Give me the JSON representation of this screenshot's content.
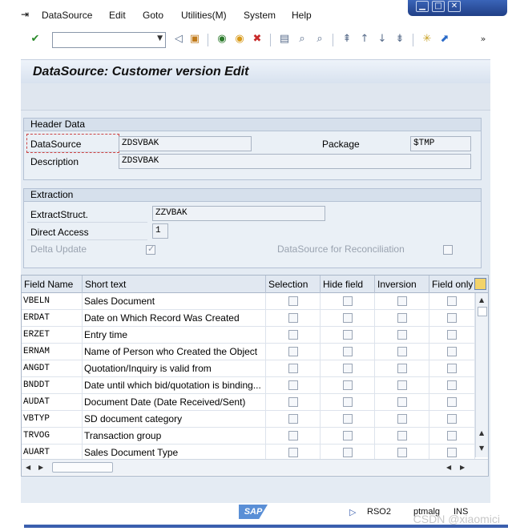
{
  "menu": {
    "items": [
      "DataSource",
      "Edit",
      "Goto",
      "Utilities(M)",
      "System",
      "Help"
    ]
  },
  "toolbar": {
    "command_value": "",
    "icons": [
      "enter-icon",
      "back-icon",
      "save-icon",
      "back-green-icon",
      "exit-icon",
      "cancel-icon",
      "print-icon",
      "find-icon",
      "find-next-icon",
      "first-page-icon",
      "previous-page-icon",
      "next-page-icon",
      "last-page-icon",
      "create-session-icon",
      "shortcut-icon",
      "more-icon"
    ]
  },
  "title": "DataSource: Customer version Edit",
  "header_data": {
    "title": "Header Data",
    "datasource_label": "DataSource",
    "datasource_value": "ZDSVBAK",
    "package_label": "Package",
    "package_value": "$TMP",
    "description_label": "Description",
    "description_value": "ZDSVBAK"
  },
  "extraction": {
    "title": "Extraction",
    "extract_struct_label": "ExtractStruct.",
    "extract_struct_value": "ZZVBAK",
    "direct_access_label": "Direct Access",
    "direct_access_value": "1",
    "delta_update_label": "Delta Update",
    "delta_update_checked": true,
    "reconciliation_label": "DataSource for Reconciliation",
    "reconciliation_checked": false
  },
  "table": {
    "columns": [
      "Field Name",
      "Short text",
      "Selection",
      "Hide field",
      "Inversion",
      "Field only"
    ],
    "rows": [
      {
        "field": "VBELN",
        "text": "Sales Document"
      },
      {
        "field": "ERDAT",
        "text": "Date on Which Record Was Created"
      },
      {
        "field": "ERZET",
        "text": "Entry time"
      },
      {
        "field": "ERNAM",
        "text": "Name of Person who Created the Object"
      },
      {
        "field": "ANGDT",
        "text": "Quotation/Inquiry is valid from"
      },
      {
        "field": "BNDDT",
        "text": "Date until which bid/quotation is binding..."
      },
      {
        "field": "AUDAT",
        "text": "Document Date (Date Received/Sent)"
      },
      {
        "field": "VBTYP",
        "text": "SD document category"
      },
      {
        "field": "TRVOG",
        "text": "Transaction group"
      },
      {
        "field": "AUART",
        "text": "Sales Document Type"
      }
    ]
  },
  "status": {
    "sap_logo": "SAP",
    "transaction": "RSO2",
    "server": "ptmalg",
    "mode": "INS",
    "watermark": "CSDN @xiaomici"
  }
}
